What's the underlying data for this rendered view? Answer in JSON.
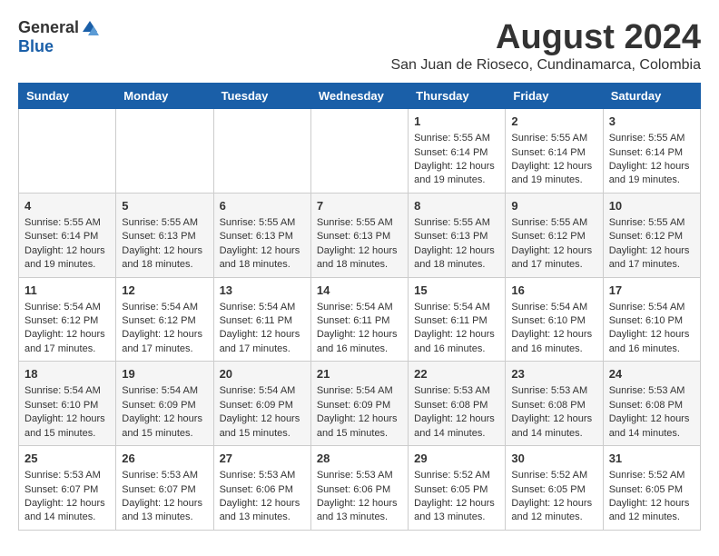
{
  "header": {
    "logo_general": "General",
    "logo_blue": "Blue",
    "month_year": "August 2024",
    "location": "San Juan de Rioseco, Cundinamarca, Colombia"
  },
  "weekdays": [
    "Sunday",
    "Monday",
    "Tuesday",
    "Wednesday",
    "Thursday",
    "Friday",
    "Saturday"
  ],
  "weeks": [
    [
      {
        "day": "",
        "sunrise": "",
        "sunset": "",
        "daylight": ""
      },
      {
        "day": "",
        "sunrise": "",
        "sunset": "",
        "daylight": ""
      },
      {
        "day": "",
        "sunrise": "",
        "sunset": "",
        "daylight": ""
      },
      {
        "day": "",
        "sunrise": "",
        "sunset": "",
        "daylight": ""
      },
      {
        "day": "1",
        "sunrise": "Sunrise: 5:55 AM",
        "sunset": "Sunset: 6:14 PM",
        "daylight": "Daylight: 12 hours and 19 minutes."
      },
      {
        "day": "2",
        "sunrise": "Sunrise: 5:55 AM",
        "sunset": "Sunset: 6:14 PM",
        "daylight": "Daylight: 12 hours and 19 minutes."
      },
      {
        "day": "3",
        "sunrise": "Sunrise: 5:55 AM",
        "sunset": "Sunset: 6:14 PM",
        "daylight": "Daylight: 12 hours and 19 minutes."
      }
    ],
    [
      {
        "day": "4",
        "sunrise": "Sunrise: 5:55 AM",
        "sunset": "Sunset: 6:14 PM",
        "daylight": "Daylight: 12 hours and 19 minutes."
      },
      {
        "day": "5",
        "sunrise": "Sunrise: 5:55 AM",
        "sunset": "Sunset: 6:13 PM",
        "daylight": "Daylight: 12 hours and 18 minutes."
      },
      {
        "day": "6",
        "sunrise": "Sunrise: 5:55 AM",
        "sunset": "Sunset: 6:13 PM",
        "daylight": "Daylight: 12 hours and 18 minutes."
      },
      {
        "day": "7",
        "sunrise": "Sunrise: 5:55 AM",
        "sunset": "Sunset: 6:13 PM",
        "daylight": "Daylight: 12 hours and 18 minutes."
      },
      {
        "day": "8",
        "sunrise": "Sunrise: 5:55 AM",
        "sunset": "Sunset: 6:13 PM",
        "daylight": "Daylight: 12 hours and 18 minutes."
      },
      {
        "day": "9",
        "sunrise": "Sunrise: 5:55 AM",
        "sunset": "Sunset: 6:12 PM",
        "daylight": "Daylight: 12 hours and 17 minutes."
      },
      {
        "day": "10",
        "sunrise": "Sunrise: 5:55 AM",
        "sunset": "Sunset: 6:12 PM",
        "daylight": "Daylight: 12 hours and 17 minutes."
      }
    ],
    [
      {
        "day": "11",
        "sunrise": "Sunrise: 5:54 AM",
        "sunset": "Sunset: 6:12 PM",
        "daylight": "Daylight: 12 hours and 17 minutes."
      },
      {
        "day": "12",
        "sunrise": "Sunrise: 5:54 AM",
        "sunset": "Sunset: 6:12 PM",
        "daylight": "Daylight: 12 hours and 17 minutes."
      },
      {
        "day": "13",
        "sunrise": "Sunrise: 5:54 AM",
        "sunset": "Sunset: 6:11 PM",
        "daylight": "Daylight: 12 hours and 17 minutes."
      },
      {
        "day": "14",
        "sunrise": "Sunrise: 5:54 AM",
        "sunset": "Sunset: 6:11 PM",
        "daylight": "Daylight: 12 hours and 16 minutes."
      },
      {
        "day": "15",
        "sunrise": "Sunrise: 5:54 AM",
        "sunset": "Sunset: 6:11 PM",
        "daylight": "Daylight: 12 hours and 16 minutes."
      },
      {
        "day": "16",
        "sunrise": "Sunrise: 5:54 AM",
        "sunset": "Sunset: 6:10 PM",
        "daylight": "Daylight: 12 hours and 16 minutes."
      },
      {
        "day": "17",
        "sunrise": "Sunrise: 5:54 AM",
        "sunset": "Sunset: 6:10 PM",
        "daylight": "Daylight: 12 hours and 16 minutes."
      }
    ],
    [
      {
        "day": "18",
        "sunrise": "Sunrise: 5:54 AM",
        "sunset": "Sunset: 6:10 PM",
        "daylight": "Daylight: 12 hours and 15 minutes."
      },
      {
        "day": "19",
        "sunrise": "Sunrise: 5:54 AM",
        "sunset": "Sunset: 6:09 PM",
        "daylight": "Daylight: 12 hours and 15 minutes."
      },
      {
        "day": "20",
        "sunrise": "Sunrise: 5:54 AM",
        "sunset": "Sunset: 6:09 PM",
        "daylight": "Daylight: 12 hours and 15 minutes."
      },
      {
        "day": "21",
        "sunrise": "Sunrise: 5:54 AM",
        "sunset": "Sunset: 6:09 PM",
        "daylight": "Daylight: 12 hours and 15 minutes."
      },
      {
        "day": "22",
        "sunrise": "Sunrise: 5:53 AM",
        "sunset": "Sunset: 6:08 PM",
        "daylight": "Daylight: 12 hours and 14 minutes."
      },
      {
        "day": "23",
        "sunrise": "Sunrise: 5:53 AM",
        "sunset": "Sunset: 6:08 PM",
        "daylight": "Daylight: 12 hours and 14 minutes."
      },
      {
        "day": "24",
        "sunrise": "Sunrise: 5:53 AM",
        "sunset": "Sunset: 6:08 PM",
        "daylight": "Daylight: 12 hours and 14 minutes."
      }
    ],
    [
      {
        "day": "25",
        "sunrise": "Sunrise: 5:53 AM",
        "sunset": "Sunset: 6:07 PM",
        "daylight": "Daylight: 12 hours and 14 minutes."
      },
      {
        "day": "26",
        "sunrise": "Sunrise: 5:53 AM",
        "sunset": "Sunset: 6:07 PM",
        "daylight": "Daylight: 12 hours and 13 minutes."
      },
      {
        "day": "27",
        "sunrise": "Sunrise: 5:53 AM",
        "sunset": "Sunset: 6:06 PM",
        "daylight": "Daylight: 12 hours and 13 minutes."
      },
      {
        "day": "28",
        "sunrise": "Sunrise: 5:53 AM",
        "sunset": "Sunset: 6:06 PM",
        "daylight": "Daylight: 12 hours and 13 minutes."
      },
      {
        "day": "29",
        "sunrise": "Sunrise: 5:52 AM",
        "sunset": "Sunset: 6:05 PM",
        "daylight": "Daylight: 12 hours and 13 minutes."
      },
      {
        "day": "30",
        "sunrise": "Sunrise: 5:52 AM",
        "sunset": "Sunset: 6:05 PM",
        "daylight": "Daylight: 12 hours and 12 minutes."
      },
      {
        "day": "31",
        "sunrise": "Sunrise: 5:52 AM",
        "sunset": "Sunset: 6:05 PM",
        "daylight": "Daylight: 12 hours and 12 minutes."
      }
    ]
  ]
}
